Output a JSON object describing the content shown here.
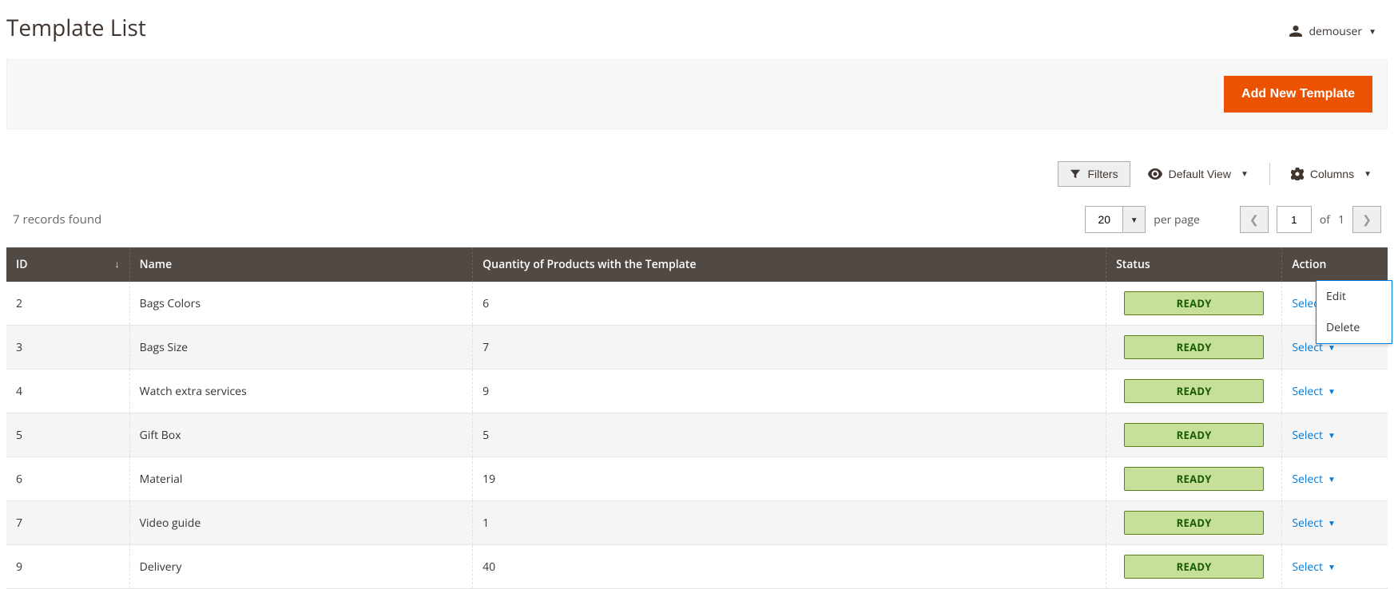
{
  "header": {
    "title": "Template List",
    "user": "demouser"
  },
  "primary_action": {
    "label": "Add New Template"
  },
  "toolbar": {
    "filters": "Filters",
    "default_view": "Default View",
    "columns": "Columns"
  },
  "records_summary": "7 records found",
  "pagination": {
    "page_size": "20",
    "per_page_label": "per page",
    "current_page": "1",
    "of_label": "of",
    "total_pages": "1"
  },
  "columns": {
    "id": "ID",
    "name": "Name",
    "qty": "Quantity of Products with the Template",
    "status": "Status",
    "action": "Action"
  },
  "action_labels": {
    "select": "Select",
    "edit": "Edit",
    "delete": "Delete"
  },
  "rows": [
    {
      "id": "2",
      "name": "Bags Colors",
      "qty": "6",
      "status": "READY",
      "menu_open": true
    },
    {
      "id": "3",
      "name": "Bags Size",
      "qty": "7",
      "status": "READY",
      "menu_open": false
    },
    {
      "id": "4",
      "name": "Watch extra services",
      "qty": "9",
      "status": "READY",
      "menu_open": false
    },
    {
      "id": "5",
      "name": "Gift Box",
      "qty": "5",
      "status": "READY",
      "menu_open": false
    },
    {
      "id": "6",
      "name": "Material",
      "qty": "19",
      "status": "READY",
      "menu_open": false
    },
    {
      "id": "7",
      "name": "Video guide",
      "qty": "1",
      "status": "READY",
      "menu_open": false
    },
    {
      "id": "9",
      "name": "Delivery",
      "qty": "40",
      "status": "READY",
      "menu_open": false
    }
  ]
}
